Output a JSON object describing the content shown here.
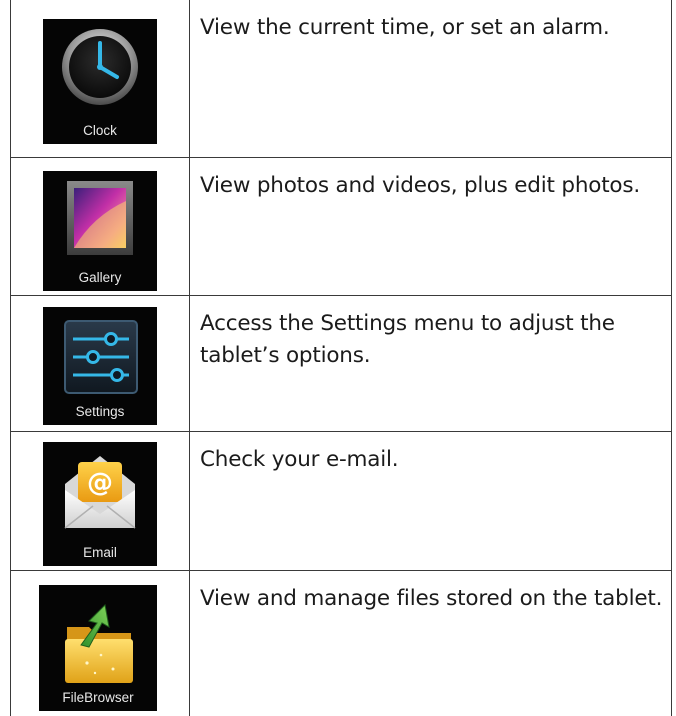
{
  "apps": [
    {
      "icon": "clock-icon",
      "label": "Clock",
      "description": "View the current time, or set an alarm."
    },
    {
      "icon": "gallery-icon",
      "label": "Gallery",
      "description": "View photos and videos, plus edit photos."
    },
    {
      "icon": "settings-icon",
      "label": "Settings",
      "description": "Access the Settings menu to adjust the tablet’s options."
    },
    {
      "icon": "email-icon",
      "label": "Email",
      "description": "Check your e-mail."
    },
    {
      "icon": "file-browser-icon",
      "label": "FileBrowser",
      "description": "View and manage files stored on the tablet."
    }
  ],
  "colors": {
    "border": "#3a3a3a",
    "tile_background": "#050505",
    "text": "#1b1b1b",
    "accent_blue": "#35b8e8",
    "email_yellow": "#f5b51d",
    "folder_green": "#4aa53a"
  }
}
